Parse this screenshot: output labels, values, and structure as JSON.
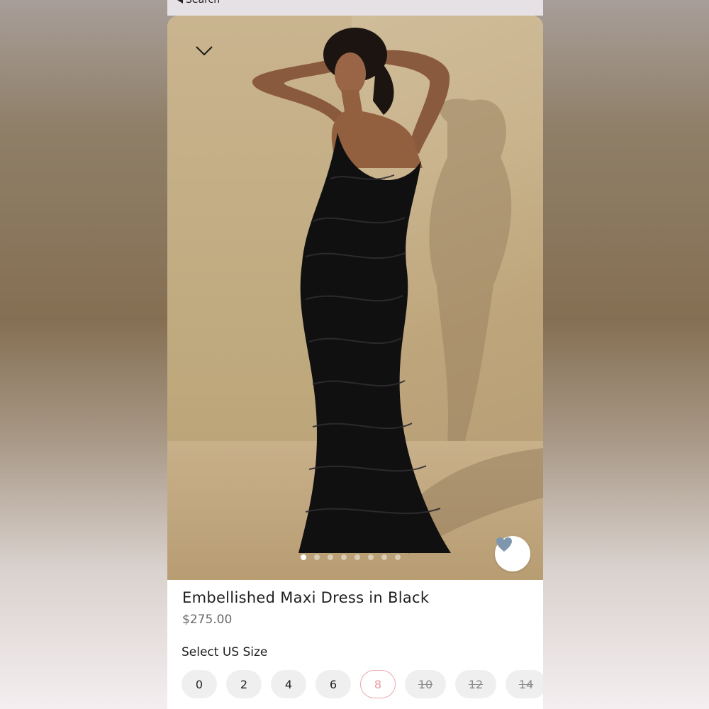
{
  "nav": {
    "back_label": "Search"
  },
  "product": {
    "title": "Embellished Maxi Dress in Black",
    "price": "$275.00",
    "image_count": 8,
    "active_image": 1,
    "favorite_icon": "heart-icon"
  },
  "size_selector": {
    "label": "Select US Size",
    "selected": "8",
    "options": [
      {
        "label": "0",
        "available": true
      },
      {
        "label": "2",
        "available": true
      },
      {
        "label": "4",
        "available": true
      },
      {
        "label": "6",
        "available": true
      },
      {
        "label": "8",
        "available": true
      },
      {
        "label": "10",
        "available": false
      },
      {
        "label": "12",
        "available": false
      },
      {
        "label": "14",
        "available": false
      }
    ]
  },
  "colors": {
    "accent_selected": "#e59aa0",
    "heart": "#7f97ad"
  }
}
